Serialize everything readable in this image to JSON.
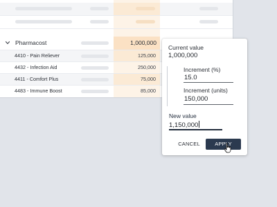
{
  "table": {
    "parent": {
      "label": "Pharmacost",
      "value": "1,000,000"
    },
    "children": [
      {
        "label": "4410 - Pain Reliever",
        "value": "125,000"
      },
      {
        "label": "4432 - Infection Aid",
        "value": "250,000"
      },
      {
        "label": "4411 - Comfort Plus",
        "value": "75,000"
      },
      {
        "label": "4483 - Immune Boost",
        "value": "85,000"
      }
    ],
    "icons": {
      "expand": "chevron-down-icon"
    }
  },
  "popover": {
    "current_value_label": "Current value",
    "current_value": "1,000,000",
    "increment_percent_label": "Increment (%)",
    "increment_percent_value": "15.0",
    "increment_units_label": "Increment (units)",
    "increment_units_value": "150,000",
    "new_value_label": "New value",
    "new_value": "1,150,000",
    "cancel_label": "CANCEL",
    "apply_label": "APPLY"
  },
  "colors": {
    "highlight_column": "#fdf3e7",
    "highlight_parent": "#fbe1c4",
    "apply_button": "#2b3a4f",
    "background": "#e1e4ea"
  },
  "cursor": {
    "icon": "hand-pointer-icon"
  }
}
